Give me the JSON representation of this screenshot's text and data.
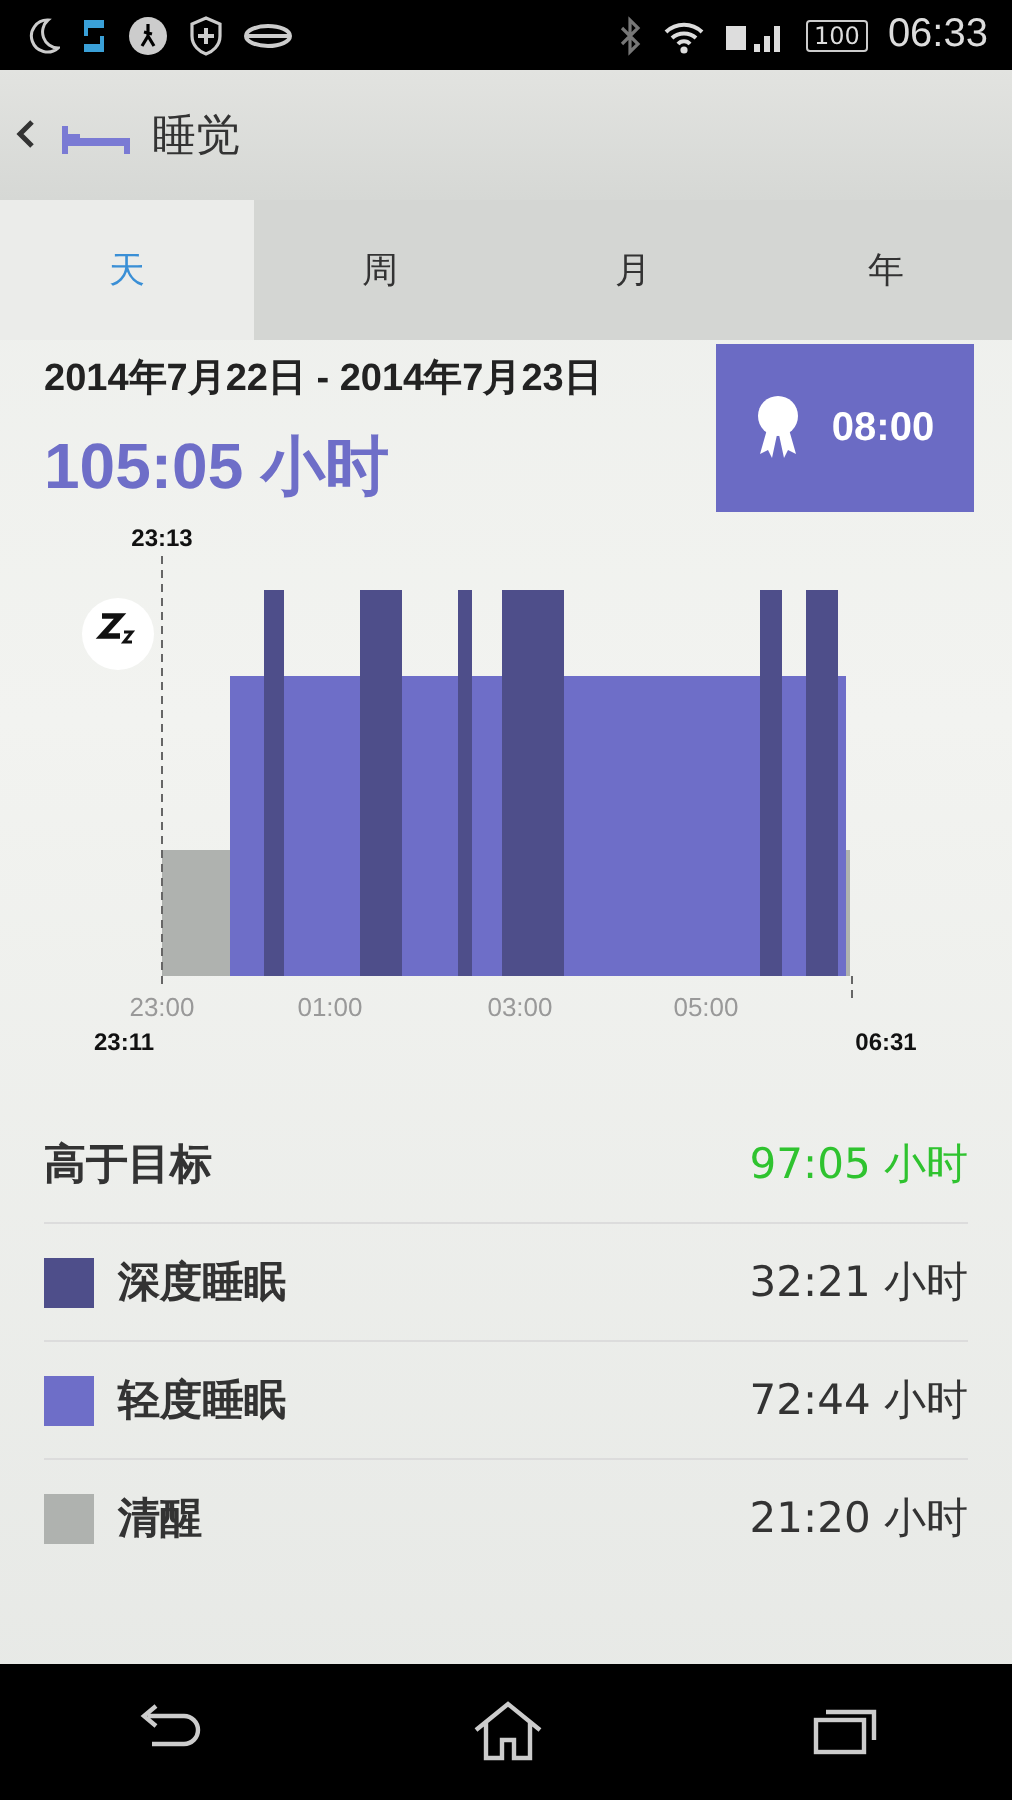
{
  "status_bar": {
    "battery": "100",
    "time": "06:33"
  },
  "header": {
    "title": "睡觉"
  },
  "tabs": [
    {
      "label": "天",
      "selected": true
    },
    {
      "label": "周",
      "selected": false
    },
    {
      "label": "月",
      "selected": false
    },
    {
      "label": "年",
      "selected": false
    }
  ],
  "summary": {
    "date_range": "2014年7月22日 - 2014年7月23日",
    "total": "105:05 小时",
    "goal": "08:00"
  },
  "chart": {
    "start_marker": "23:13",
    "end_marker_left": "23:11",
    "end_marker_right": "06:31",
    "x_ticks": [
      "23:00",
      "01:00",
      "03:00",
      "05:00"
    ]
  },
  "stats": [
    {
      "kind": "goal",
      "label": "高于目标",
      "value": "97:05 小时"
    },
    {
      "kind": "legend",
      "label": "深度睡眠",
      "value": "32:21 小时",
      "color": "#4e4e8a"
    },
    {
      "kind": "legend",
      "label": "轻度睡眠",
      "value": "72:44 小时",
      "color": "#6e6ec8"
    },
    {
      "kind": "legend",
      "label": "清醒",
      "value": "21:20 小时",
      "color": "#afb2af"
    }
  ]
}
